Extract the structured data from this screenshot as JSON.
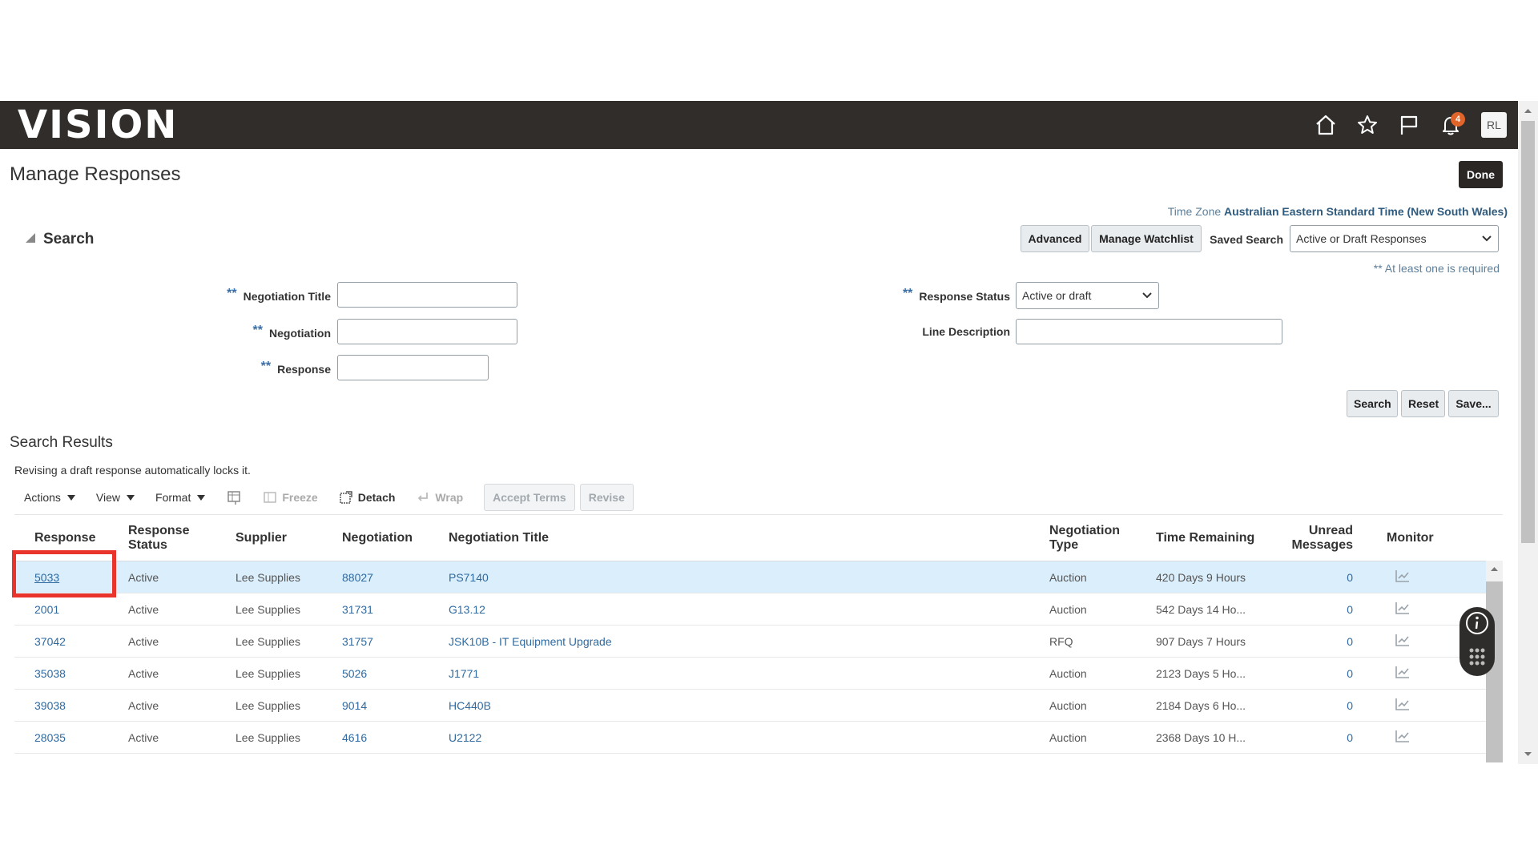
{
  "header": {
    "logo_text": "VISION",
    "icons": [
      "home-icon",
      "star-icon",
      "flag-icon",
      "bell-icon"
    ],
    "notification_count": "4",
    "user_initials": "RL"
  },
  "page": {
    "title": "Manage Responses",
    "done_label": "Done",
    "timezone_label": "Time Zone",
    "timezone_value": "Australian Eastern Standard Time (New South Wales)"
  },
  "search": {
    "heading": "Search",
    "advanced_label": "Advanced",
    "manage_watchlist_label": "Manage Watchlist",
    "saved_search_label": "Saved Search",
    "saved_search_value": "Active or Draft Responses",
    "required_hint": "** At least one is required",
    "required_marker": "**",
    "fields": {
      "negotiation_title": {
        "label": "Negotiation Title",
        "value": ""
      },
      "negotiation": {
        "label": "Negotiation",
        "value": ""
      },
      "response": {
        "label": "Response",
        "value": ""
      },
      "response_status": {
        "label": "Response Status",
        "value": "Active or draft"
      },
      "line_description": {
        "label": "Line Description",
        "value": ""
      }
    },
    "search_btn": "Search",
    "reset_btn": "Reset",
    "save_btn": "Save..."
  },
  "results": {
    "heading": "Search Results",
    "info": "Revising a draft response automatically locks it.",
    "toolbar": {
      "actions": "Actions",
      "view": "View",
      "format": "Format",
      "freeze": "Freeze",
      "detach": "Detach",
      "wrap": "Wrap",
      "accept_terms": "Accept Terms",
      "revise": "Revise"
    },
    "columns": {
      "response": "Response",
      "status": "Response Status",
      "supplier": "Supplier",
      "negotiation": "Negotiation",
      "title": "Negotiation Title",
      "type": "Negotiation Type",
      "time": "Time Remaining",
      "unread": "Unread Messages",
      "monitor": "Monitor"
    },
    "rows": [
      {
        "response": "5033",
        "status": "Active",
        "supplier": "Lee Supplies",
        "negotiation": "88027",
        "title": "PS7140",
        "type": "Auction",
        "time": "420 Days 9 Hours",
        "unread": "0"
      },
      {
        "response": "2001",
        "status": "Active",
        "supplier": "Lee Supplies",
        "negotiation": "31731",
        "title": "G13.12",
        "type": "Auction",
        "time": "542 Days 14 Ho...",
        "unread": "0"
      },
      {
        "response": "37042",
        "status": "Active",
        "supplier": "Lee Supplies",
        "negotiation": "31757",
        "title": "JSK10B - IT Equipment Upgrade",
        "type": "RFQ",
        "time": "907 Days 7 Hours",
        "unread": "0"
      },
      {
        "response": "35038",
        "status": "Active",
        "supplier": "Lee Supplies",
        "negotiation": "5026",
        "title": "J1771",
        "type": "Auction",
        "time": "2123 Days 5 Ho...",
        "unread": "0"
      },
      {
        "response": "39038",
        "status": "Active",
        "supplier": "Lee Supplies",
        "negotiation": "9014",
        "title": "HC440B",
        "type": "Auction",
        "time": "2184 Days 6 Ho...",
        "unread": "0"
      },
      {
        "response": "28035",
        "status": "Active",
        "supplier": "Lee Supplies",
        "negotiation": "4616",
        "title": "U2122",
        "type": "Auction",
        "time": "2368 Days 10 H...",
        "unread": "0"
      }
    ]
  }
}
